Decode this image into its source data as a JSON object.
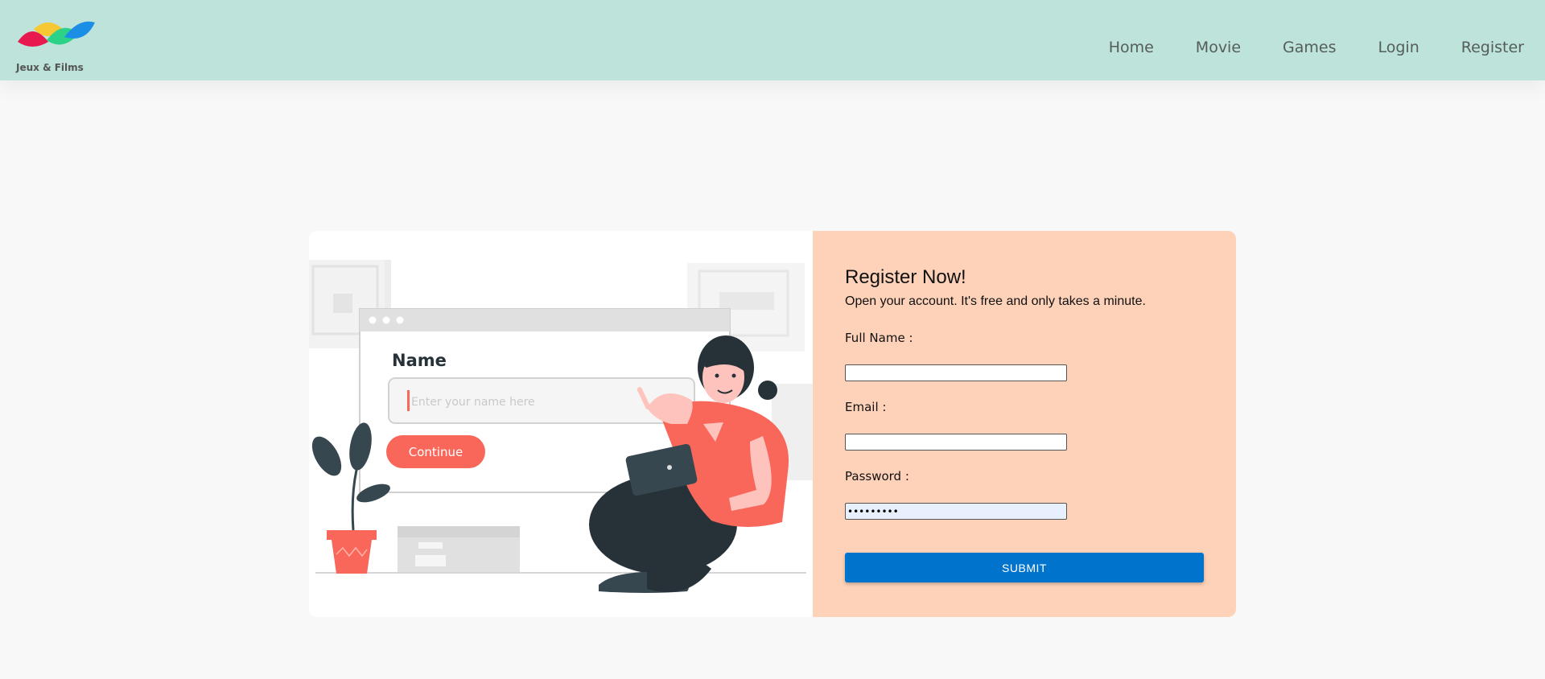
{
  "header": {
    "brand": "Jeux & Films",
    "nav": [
      "Home",
      "Movie",
      "Games",
      "Login",
      "Register"
    ]
  },
  "illustration": {
    "field_label": "Name",
    "field_placeholder": "Enter your name here",
    "button_label": "Continue"
  },
  "form": {
    "title": "Register Now!",
    "subtitle": "Open your account. It's free and only takes a minute.",
    "full_name_label": "Full Name :",
    "full_name_value": "",
    "email_label": "Email :",
    "email_value": "",
    "password_label": "Password :",
    "password_value": "•••••••••",
    "submit_label": "SUBMIT"
  },
  "colors": {
    "header_bg": "#bde3da",
    "panel_bg": "#fed2b9",
    "submit_bg": "#0074cc",
    "accent": "#f9675b"
  }
}
